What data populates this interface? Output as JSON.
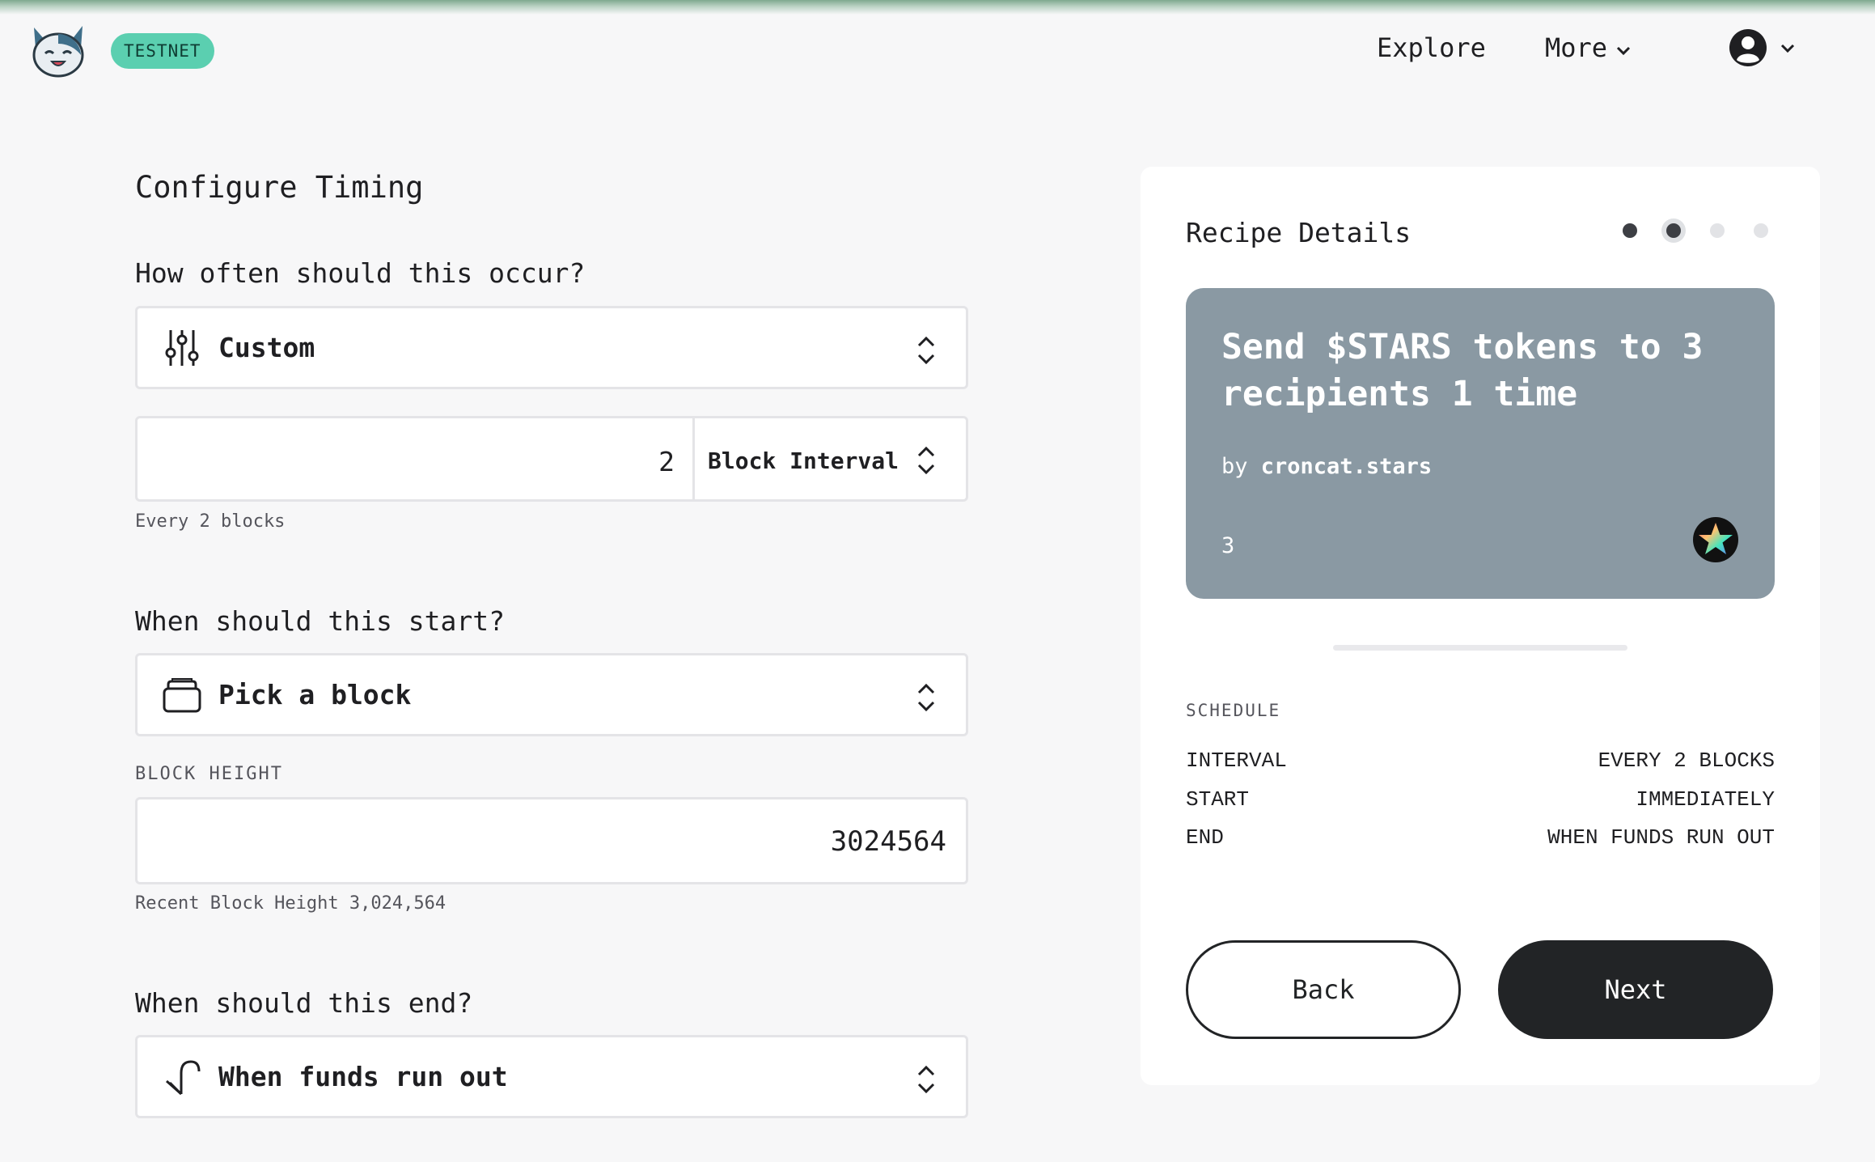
{
  "header": {
    "network_badge": "TESTNET",
    "nav": {
      "explore": "Explore",
      "more": "More"
    }
  },
  "form": {
    "title": "Configure Timing",
    "frequency": {
      "question": "How often should this occur?",
      "selected": "Custom",
      "icon": "sliders-icon",
      "interval_value": "2",
      "interval_unit": "Block Interval",
      "help": "Every 2 blocks"
    },
    "start": {
      "question": "When should this start?",
      "selected": "Pick a block",
      "icon": "block-stack-icon",
      "block_height_label": "BLOCK HEIGHT",
      "block_height_value": "3024564",
      "help": "Recent Block Height 3,024,564"
    },
    "end": {
      "question": "When should this end?",
      "selected": "When funds run out",
      "icon": "return-arrow-icon"
    }
  },
  "recipe": {
    "heading": "Recipe Details",
    "steps_total": 4,
    "step_active": 2,
    "card": {
      "name": "Send $STARS tokens to 3 recipients 1 time",
      "by_prefix": "by",
      "author": "croncat.stars",
      "count": "3",
      "bg_color": "#8a99a3"
    },
    "schedule": {
      "heading": "SCHEDULE",
      "rows": [
        {
          "label": "INTERVAL",
          "value": "EVERY 2 BLOCKS"
        },
        {
          "label": "START",
          "value": "IMMEDIATELY"
        },
        {
          "label": "END",
          "value": "WHEN FUNDS RUN OUT"
        }
      ]
    }
  },
  "actions": {
    "back": "Back",
    "next": "Next"
  }
}
